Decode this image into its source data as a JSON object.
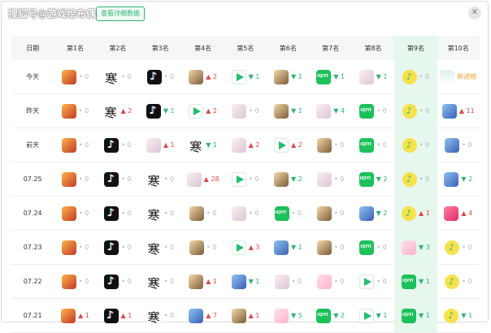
{
  "watermark": "搜狐号@游戏绘布偶",
  "detail_button": "查看详细数据",
  "close_icon": "close-icon",
  "colors": {
    "up": "#e04848",
    "down": "#2bb673",
    "new": "#f3a12b",
    "highlight": "#e6f7ee"
  },
  "headers": [
    "日期",
    "第1名",
    "第2名",
    "第3名",
    "第4名",
    "第5名",
    "第6名",
    "第7名",
    "第8名",
    "第9名",
    "第10名"
  ],
  "rows": [
    {
      "date": "今天",
      "cells": [
        {
          "icon": "honor-of-kings",
          "arrow": "same",
          "change": "0"
        },
        {
          "icon": "ink-game",
          "arrow": "same",
          "change": "0"
        },
        {
          "icon": "douyin",
          "arrow": "same",
          "change": "0"
        },
        {
          "icon": "genshin",
          "arrow": "up",
          "change": "2"
        },
        {
          "icon": "tencent-video",
          "arrow": "down",
          "change": "1"
        },
        {
          "icon": "genshin",
          "arrow": "down",
          "change": "1"
        },
        {
          "icon": "iqiyi",
          "arrow": "down",
          "change": "1"
        },
        {
          "icon": "anime-girl",
          "arrow": "down",
          "change": "1"
        },
        {
          "icon": "qq-music",
          "arrow": "same",
          "change": "0"
        },
        {
          "icon": "panda",
          "arrow": "new",
          "change": "新进榜"
        }
      ]
    },
    {
      "date": "昨天",
      "cells": [
        {
          "icon": "honor-of-kings",
          "arrow": "same",
          "change": "0"
        },
        {
          "icon": "ink-game",
          "arrow": "up",
          "change": "2"
        },
        {
          "icon": "douyin",
          "arrow": "down",
          "change": "1"
        },
        {
          "icon": "tencent-video",
          "arrow": "up",
          "change": "2"
        },
        {
          "icon": "anime-girl",
          "arrow": "same",
          "change": "0"
        },
        {
          "icon": "genshin",
          "arrow": "down",
          "change": "1"
        },
        {
          "icon": "anime-girl",
          "arrow": "down",
          "change": "4"
        },
        {
          "icon": "iqiyi",
          "arrow": "same",
          "change": "0"
        },
        {
          "icon": "qq-music",
          "arrow": "same",
          "change": "0"
        },
        {
          "icon": "anime-blue",
          "arrow": "up",
          "change": "11"
        }
      ]
    },
    {
      "date": "前天",
      "cells": [
        {
          "icon": "honor-of-kings",
          "arrow": "same",
          "change": "0"
        },
        {
          "icon": "douyin",
          "arrow": "same",
          "change": "0"
        },
        {
          "icon": "anime-girl",
          "arrow": "up",
          "change": "1"
        },
        {
          "icon": "ink-game",
          "arrow": "down",
          "change": "1"
        },
        {
          "icon": "anime-girl",
          "arrow": "up",
          "change": "2"
        },
        {
          "icon": "tencent-video",
          "arrow": "up",
          "change": "2"
        },
        {
          "icon": "genshin",
          "arrow": "same",
          "change": "0"
        },
        {
          "icon": "iqiyi",
          "arrow": "same",
          "change": "0"
        },
        {
          "icon": "qq-music",
          "arrow": "same",
          "change": "0"
        },
        {
          "icon": "anime-blue",
          "arrow": "same",
          "change": "0"
        }
      ]
    },
    {
      "date": "07.25",
      "cells": [
        {
          "icon": "honor-of-kings",
          "arrow": "same",
          "change": "0"
        },
        {
          "icon": "douyin",
          "arrow": "same",
          "change": "0"
        },
        {
          "icon": "ink-game",
          "arrow": "same",
          "change": "0"
        },
        {
          "icon": "anime-girl",
          "arrow": "up",
          "change": "28"
        },
        {
          "icon": "tencent-video",
          "arrow": "same",
          "change": "0"
        },
        {
          "icon": "genshin",
          "arrow": "down",
          "change": "2"
        },
        {
          "icon": "anime-girl",
          "arrow": "same",
          "change": "0"
        },
        {
          "icon": "iqiyi",
          "arrow": "down",
          "change": "2"
        },
        {
          "icon": "qq-music",
          "arrow": "same",
          "change": "0"
        },
        {
          "icon": "anime-blue",
          "arrow": "down",
          "change": "2"
        }
      ]
    },
    {
      "date": "07.24",
      "cells": [
        {
          "icon": "honor-of-kings",
          "arrow": "same",
          "change": "0"
        },
        {
          "icon": "douyin",
          "arrow": "same",
          "change": "0"
        },
        {
          "icon": "ink-game",
          "arrow": "same",
          "change": "0"
        },
        {
          "icon": "genshin",
          "arrow": "same",
          "change": "0"
        },
        {
          "icon": "anime-girl",
          "arrow": "same",
          "change": "0"
        },
        {
          "icon": "iqiyi",
          "arrow": "same",
          "change": "0"
        },
        {
          "icon": "genshin",
          "arrow": "same",
          "change": "0"
        },
        {
          "icon": "anime-blue",
          "arrow": "down",
          "change": "2"
        },
        {
          "icon": "qq-music",
          "arrow": "up",
          "change": "1"
        },
        {
          "icon": "red-game",
          "arrow": "up",
          "change": "4"
        }
      ]
    },
    {
      "date": "07.23",
      "cells": [
        {
          "icon": "honor-of-kings",
          "arrow": "same",
          "change": "0"
        },
        {
          "icon": "douyin",
          "arrow": "same",
          "change": "0"
        },
        {
          "icon": "ink-game",
          "arrow": "same",
          "change": "0"
        },
        {
          "icon": "genshin",
          "arrow": "same",
          "change": "0"
        },
        {
          "icon": "tencent-video",
          "arrow": "up",
          "change": "3"
        },
        {
          "icon": "anime-blue",
          "arrow": "down",
          "change": "1"
        },
        {
          "icon": "genshin",
          "arrow": "same",
          "change": "0"
        },
        {
          "icon": "iqiyi",
          "arrow": "same",
          "change": "0"
        },
        {
          "icon": "pink-girl",
          "arrow": "down",
          "change": "3"
        },
        {
          "icon": "qq-music",
          "arrow": "same",
          "change": "0"
        }
      ]
    },
    {
      "date": "07.22",
      "cells": [
        {
          "icon": "honor-of-kings",
          "arrow": "same",
          "change": "0"
        },
        {
          "icon": "douyin",
          "arrow": "same",
          "change": "0"
        },
        {
          "icon": "ink-game",
          "arrow": "same",
          "change": "0"
        },
        {
          "icon": "genshin",
          "arrow": "up",
          "change": "1"
        },
        {
          "icon": "anime-blue",
          "arrow": "down",
          "change": "1"
        },
        {
          "icon": "anime-girl",
          "arrow": "same",
          "change": "0"
        },
        {
          "icon": "pink-girl",
          "arrow": "same",
          "change": "0"
        },
        {
          "icon": "tencent-video",
          "arrow": "same",
          "change": "0"
        },
        {
          "icon": "iqiyi",
          "arrow": "down",
          "change": "1"
        },
        {
          "icon": "qq-music",
          "arrow": "same",
          "change": "0"
        }
      ]
    },
    {
      "date": "07.21",
      "cells": [
        {
          "icon": "honor-of-kings",
          "arrow": "up",
          "change": "1"
        },
        {
          "icon": "douyin",
          "arrow": "up",
          "change": "1"
        },
        {
          "icon": "ink-game",
          "arrow": "same",
          "change": "0"
        },
        {
          "icon": "anime-blue",
          "arrow": "up",
          "change": "7"
        },
        {
          "icon": "genshin",
          "arrow": "up",
          "change": "1"
        },
        {
          "icon": "pink-girl",
          "arrow": "down",
          "change": "5"
        },
        {
          "icon": "iqiyi",
          "arrow": "down",
          "change": "2"
        },
        {
          "icon": "tencent-video",
          "arrow": "down",
          "change": "1"
        },
        {
          "icon": "iqiyi",
          "arrow": "down",
          "change": "1"
        },
        {
          "icon": "qq-music",
          "arrow": "down",
          "change": "1"
        }
      ]
    }
  ]
}
